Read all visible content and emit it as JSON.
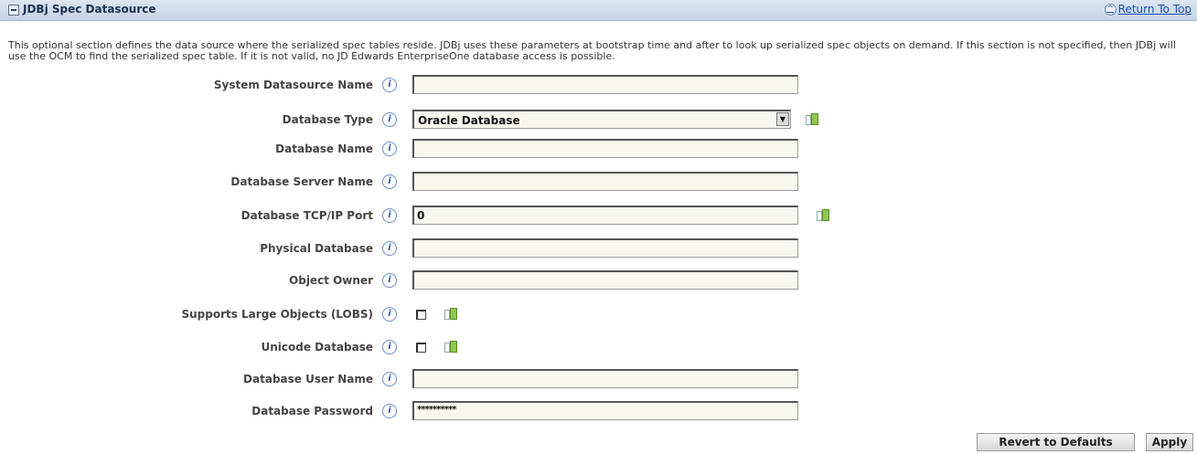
{
  "section": {
    "title": "JDBj Spec Datasource",
    "return_to_top": "Return To Top",
    "description": "This optional section defines the data source where the serialized spec tables reside. JDBj uses these parameters at bootstrap time and after to look up serialized spec objects on demand. If this section is not specified, then JDBj will use the OCM to find the serialized spec table. If it is not valid, no JD Edwards EnterpriseOne database access is possible."
  },
  "fields": {
    "system_datasource_name": {
      "label": "System Datasource Name",
      "value": ""
    },
    "database_type": {
      "label": "Database Type",
      "value": "Oracle Database"
    },
    "database_name": {
      "label": "Database Name",
      "value": ""
    },
    "database_server_name": {
      "label": "Database Server Name",
      "value": ""
    },
    "database_tcp_ip_port": {
      "label": "Database TCP/IP Port",
      "value": "0"
    },
    "physical_database": {
      "label": "Physical Database",
      "value": ""
    },
    "object_owner": {
      "label": "Object Owner",
      "value": ""
    },
    "supports_large_objects": {
      "label": "Supports Large Objects (LOBS)",
      "checked": false
    },
    "unicode_database": {
      "label": "Unicode Database",
      "checked": false
    },
    "database_user_name": {
      "label": "Database User Name",
      "value": ""
    },
    "database_password": {
      "label": "Database Password",
      "value": "**********"
    }
  },
  "buttons": {
    "revert": "Revert to Defaults",
    "apply": "Apply"
  },
  "icons": {
    "info": "info-icon",
    "override": "override-indicator-icon",
    "collapse": "collapse-minus-icon",
    "return_top": "up-arrow-icon"
  }
}
